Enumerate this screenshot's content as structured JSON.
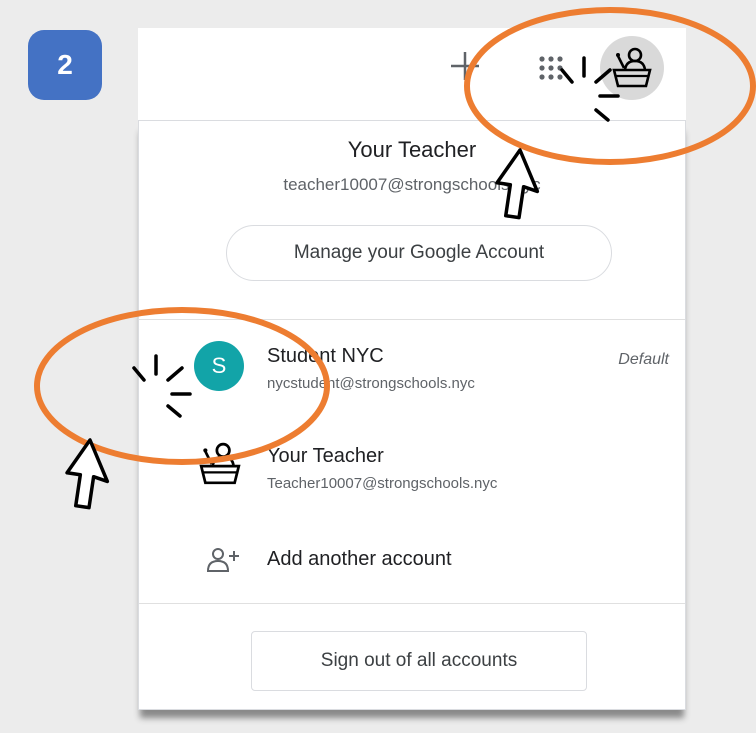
{
  "step": {
    "number": "2"
  },
  "topbar": {
    "icons": [
      "plus-icon",
      "apps-grid-icon",
      "teacher-avatar-icon"
    ]
  },
  "account_menu": {
    "current": {
      "name": "Your Teacher",
      "email": "teacher10007@strongschools.nyc",
      "manage_label": "Manage your Google Account"
    },
    "accounts": [
      {
        "initial": "S",
        "name": "Student NYC",
        "email": "nycstudent@strongschools.nyc",
        "badge": "Default",
        "avatar_color": "#12a4a8"
      },
      {
        "name": "Your Teacher",
        "email": "Teacher10007@strongschools.nyc",
        "icon": "teacher-avatar-icon"
      }
    ],
    "add_account_label": "Add another account",
    "sign_out_label": "Sign out of all accounts"
  },
  "colors": {
    "badge_blue": "#4472c4",
    "highlight_orange": "#ed7d31",
    "student_avatar": "#12a4a8"
  }
}
